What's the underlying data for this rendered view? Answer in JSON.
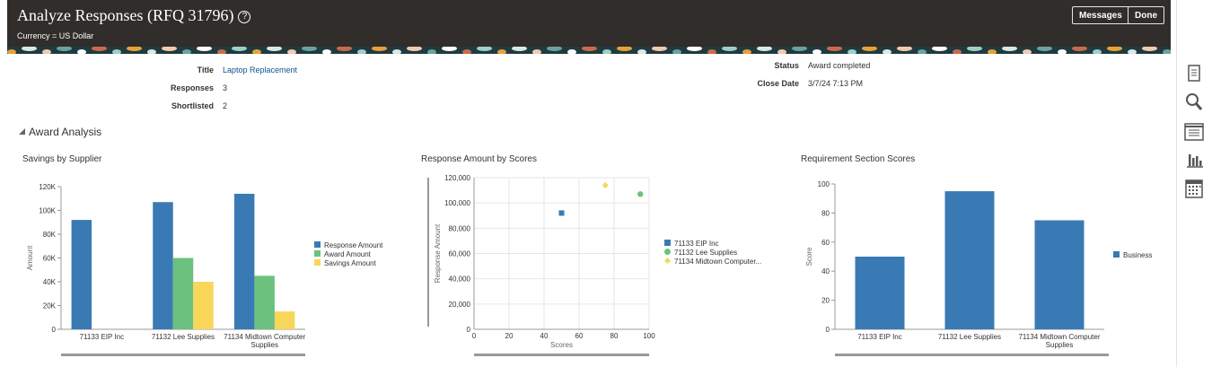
{
  "header": {
    "title": "Analyze Responses (RFQ 31796)",
    "help_icon": "question-circle-icon",
    "currency": "Currency = US Dollar",
    "messages_label": "Messages",
    "done_label": "Done"
  },
  "summary": {
    "title_label": "Title",
    "title_value": "Laptop Replacement",
    "responses_label": "Responses",
    "responses_value": "3",
    "shortlisted_label": "Shortlisted",
    "shortlisted_value": "2",
    "status_label": "Status",
    "status_value": "Award completed",
    "close_date_label": "Close Date",
    "close_date_value": "3/7/24 7:13 PM"
  },
  "section": {
    "title": "Award Analysis"
  },
  "sidebar": {
    "icons": [
      "document-icon",
      "search-icon",
      "list-icon",
      "bar-chart-icon",
      "calendar-icon"
    ]
  },
  "colors": {
    "blue": "#3a7ab4",
    "green": "#6cc17f",
    "yellow": "#f7d65a",
    "header": "#312d2a"
  },
  "chart_data": [
    {
      "type": "bar",
      "title": "Savings by Supplier",
      "categories": [
        "71133 EIP Inc",
        "71132 Lee Supplies",
        "71134 Midtown Computer Supplies"
      ],
      "series": [
        {
          "name": "Response Amount",
          "values": [
            92000,
            107000,
            114000
          ],
          "color": "#3a7ab4"
        },
        {
          "name": "Award Amount",
          "values": [
            0,
            60000,
            45000
          ],
          "color": "#6cc17f"
        },
        {
          "name": "Savings Amount",
          "values": [
            0,
            40000,
            15000
          ],
          "color": "#f7d65a"
        }
      ],
      "ylabel": "Amount",
      "ylim": [
        0,
        120000
      ],
      "yticks": [
        "0",
        "20K",
        "40K",
        "60K",
        "80K",
        "100K",
        "120K"
      ],
      "legend": "right"
    },
    {
      "type": "scatter",
      "title": "Response Amount by Scores",
      "xlabel": "Scores",
      "ylabel": "Response Amount",
      "xlim": [
        0,
        100
      ],
      "ylim": [
        0,
        120000
      ],
      "xticks": [
        "0",
        "20",
        "40",
        "60",
        "80",
        "100"
      ],
      "yticks": [
        "0",
        "20,000",
        "40,000",
        "60,000",
        "80,000",
        "100,000",
        "120,000"
      ],
      "series": [
        {
          "name": "71133 EIP Inc",
          "x": 50,
          "y": 92000,
          "marker": "square",
          "color": "#3a7ab4"
        },
        {
          "name": "71132 Lee Supplies",
          "x": 95,
          "y": 107000,
          "marker": "circle",
          "color": "#6cc17f"
        },
        {
          "name": "71134 Midtown Computer...",
          "x": 75,
          "y": 114000,
          "marker": "diamond",
          "color": "#f7d65a"
        }
      ],
      "grid": true,
      "legend": "right"
    },
    {
      "type": "bar",
      "title": "Requirement Section Scores",
      "categories": [
        "71133 EIP Inc",
        "71132 Lee Supplies",
        "71134 Midtown Computer Supplies"
      ],
      "series": [
        {
          "name": "Business",
          "values": [
            50,
            95,
            75
          ],
          "color": "#3a7ab4"
        }
      ],
      "ylabel": "Score",
      "ylim": [
        0,
        100
      ],
      "yticks": [
        "0",
        "20",
        "40",
        "60",
        "80",
        "100"
      ],
      "legend": "right"
    }
  ]
}
